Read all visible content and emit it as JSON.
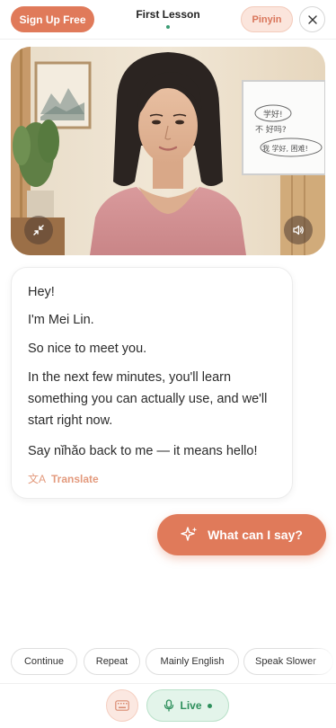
{
  "header": {
    "signup_label": "Sign Up Free",
    "title": "First Lesson",
    "pinyin_label": "Pinyin",
    "close_icon": "close-icon"
  },
  "video": {
    "whiteboard_lines": [
      "学好!",
      "不 好吗?",
      "我 学好, 困难!"
    ],
    "minimize_icon": "minimize-icon",
    "sound_icon": "speaker-icon"
  },
  "message": {
    "lines": [
      "Hey!",
      "I'm Mei Lin.",
      "So nice to meet you.",
      "In the next few minutes, you'll learn something you can actually use, and we'll start right now.",
      "Say nǐhǎo back to me — it means hello!"
    ],
    "translate_icon": "文A",
    "translate_label": "Translate"
  },
  "what_button": {
    "label": "What can I say?",
    "icon": "sparkle-icon"
  },
  "chips": [
    "Continue",
    "Repeat",
    "Mainly English",
    "Speak Slower"
  ],
  "bottom": {
    "keyboard_icon": "keyboard-icon",
    "live_label": "Live",
    "live_icon": "microphone-icon"
  },
  "colors": {
    "accent": "#e07a5a",
    "accent_soft": "#fbe5dc",
    "live_green": "#2e8f5c",
    "live_bg": "#e3f4ea"
  }
}
